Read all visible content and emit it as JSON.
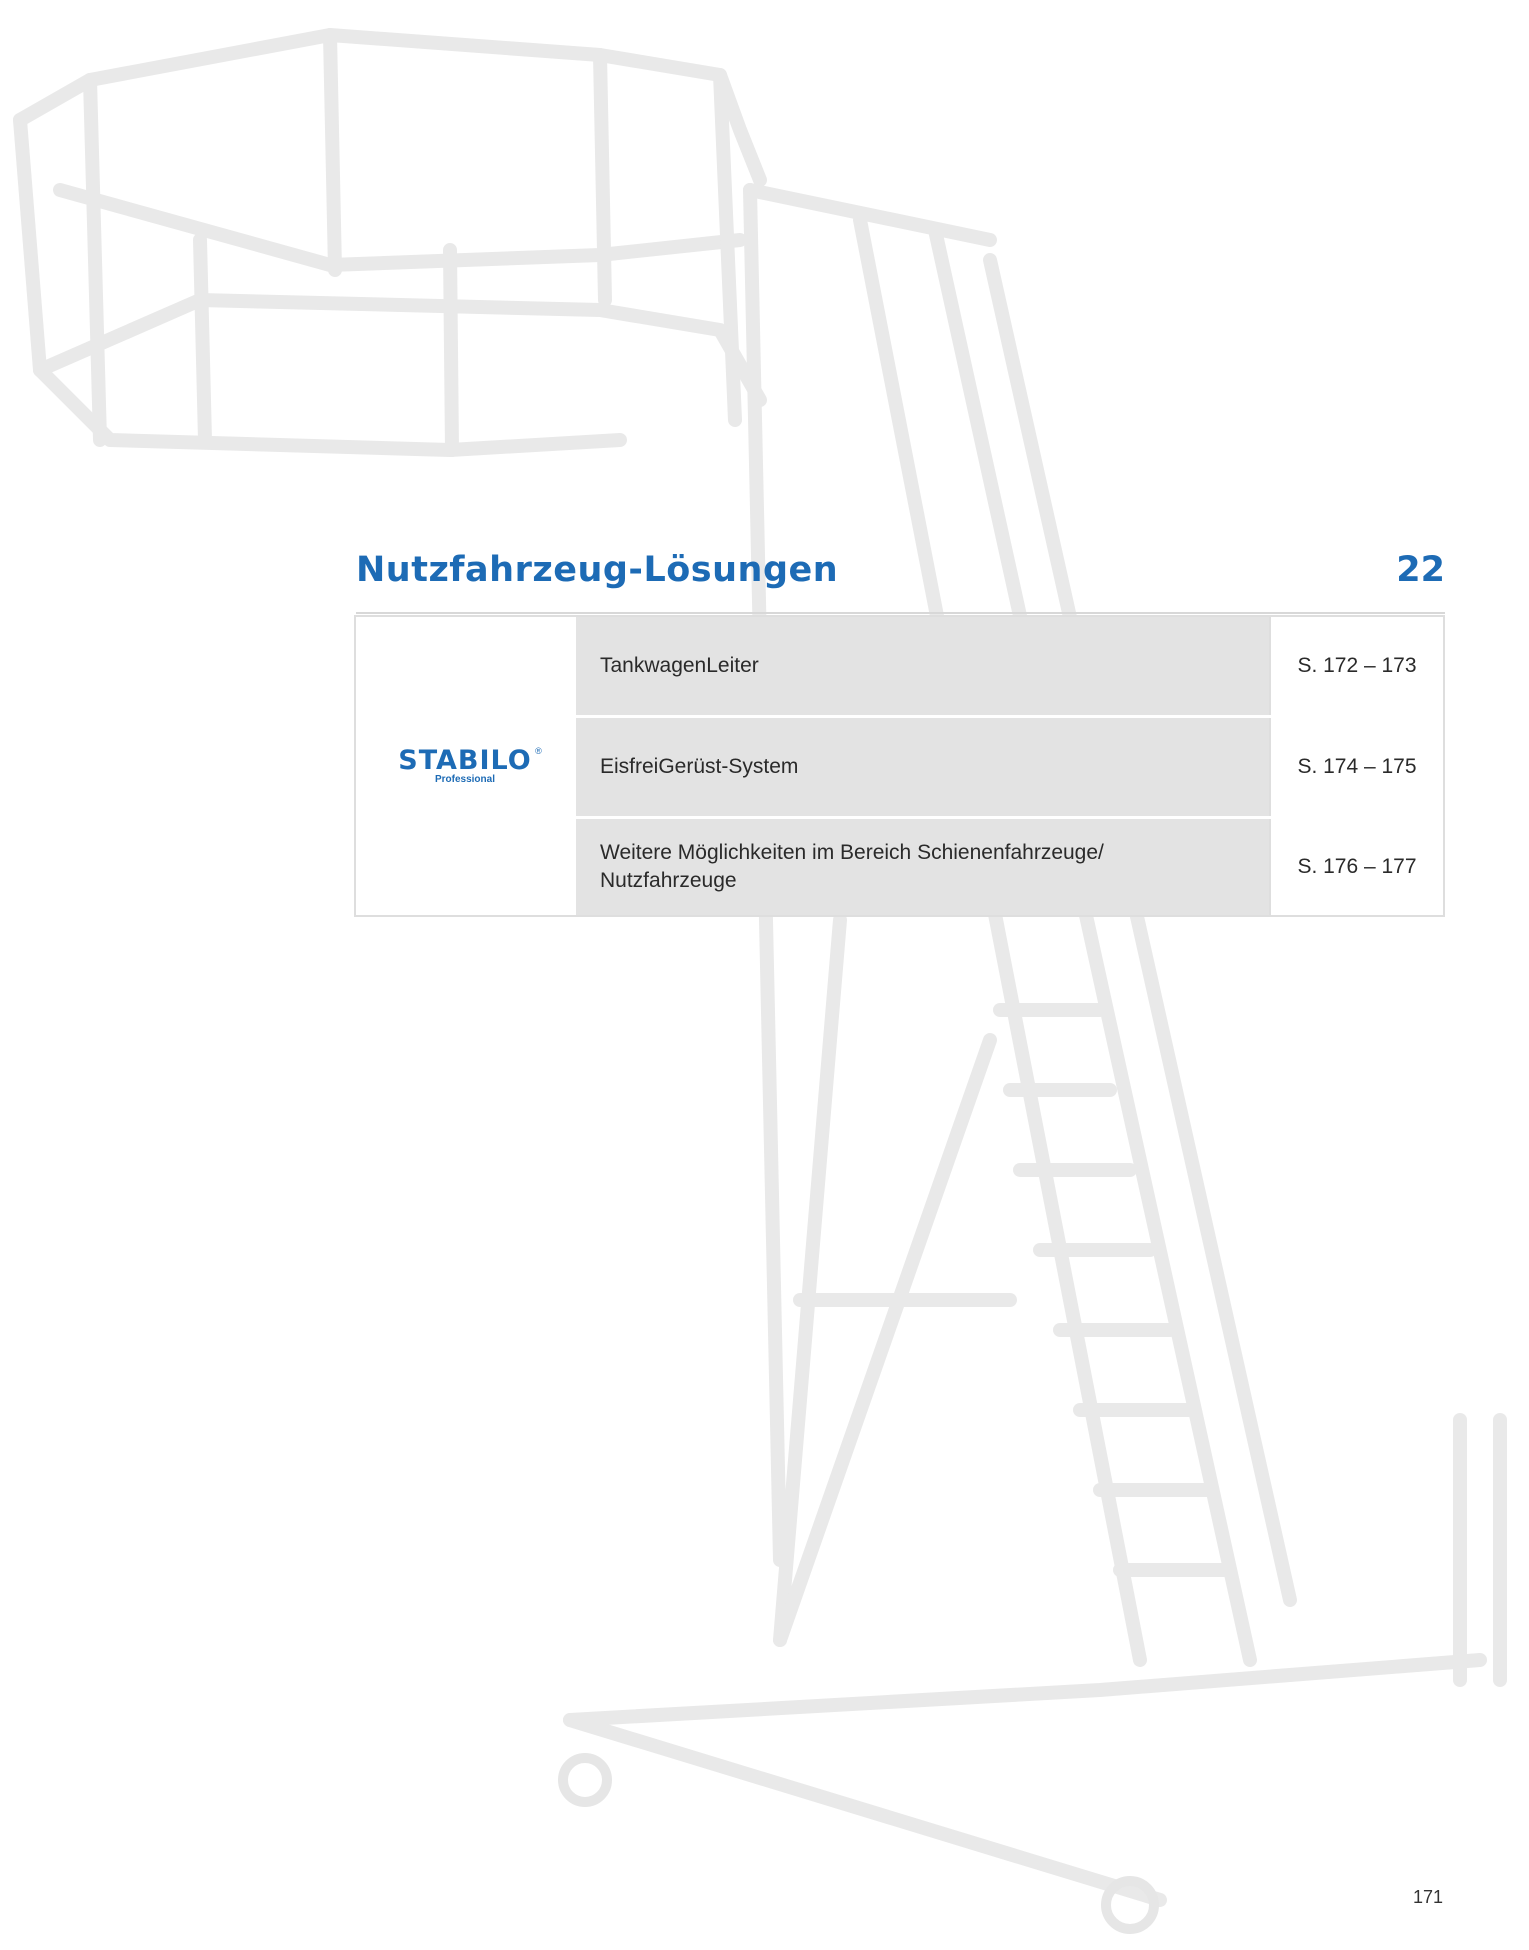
{
  "section": {
    "title": "Nutzfahrzeug-Lösungen",
    "chapter_number": "22"
  },
  "brand": {
    "logo_main": "STABILO",
    "logo_registered": "®",
    "logo_sub": "Professional"
  },
  "products": [
    {
      "name": "TankwagenLeiter",
      "pages": "S. 172 – 173"
    },
    {
      "name": "EisfreiGerüst-System",
      "pages": "S. 174 – 175"
    },
    {
      "name": "Weitere Möglichkeiten im Bereich Schienenfahrzeuge/ Nutzfahrzeuge",
      "pages": "S. 176 – 177"
    }
  ],
  "page_number": "171",
  "colors": {
    "accent_blue": "#1d6bb5",
    "row_gray": "#e1e1e1"
  }
}
